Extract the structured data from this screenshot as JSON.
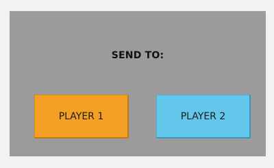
{
  "dialog": {
    "title": "SEND TO:",
    "buttons": {
      "player1": {
        "label": "PLAYER 1",
        "color": "#f4a024"
      },
      "player2": {
        "label": "PLAYER 2",
        "color": "#63c7ec"
      }
    },
    "panel_color": "#9b9b9b"
  }
}
